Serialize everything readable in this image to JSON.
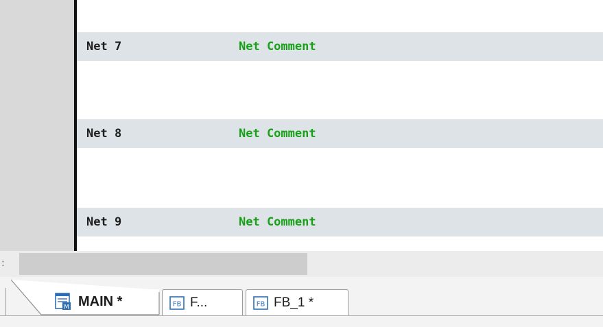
{
  "editor": {
    "networks": [
      {
        "label": "Net 7",
        "comment": "Net Comment"
      },
      {
        "label": "Net 8",
        "comment": "Net Comment"
      },
      {
        "label": "Net 9",
        "comment": "Net Comment"
      }
    ]
  },
  "scrollbar": {
    "marker": ":"
  },
  "tabs": [
    {
      "label": "MAIN *",
      "icon": "ladder-main-icon",
      "active": true
    },
    {
      "label": "F...",
      "icon": "fb-icon",
      "active": false
    },
    {
      "label": "FB_1 *",
      "icon": "fb-icon",
      "active": false
    }
  ],
  "colors": {
    "net_header_bg": "#dde3e6",
    "comment_text": "#19a019",
    "gutter": "#d9d9d9",
    "fb_icon_blue": "#2d6fb6"
  }
}
